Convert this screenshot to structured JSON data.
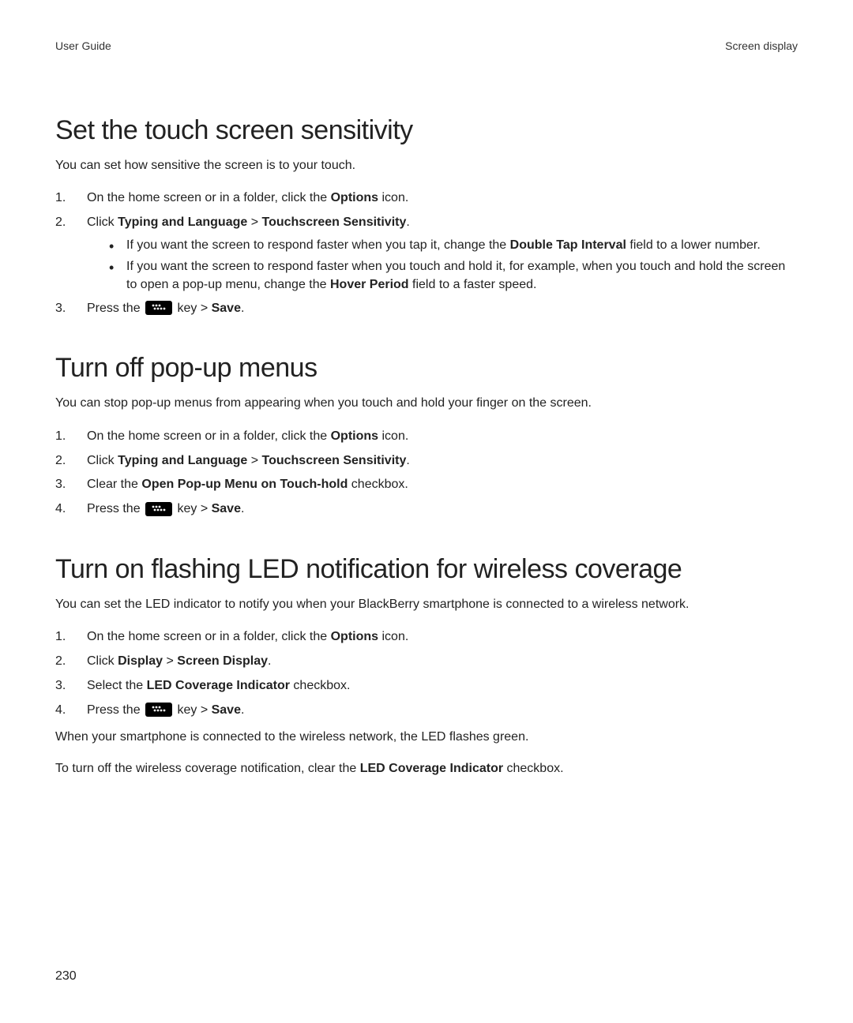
{
  "header": {
    "left": "User Guide",
    "right": "Screen display"
  },
  "page_number": "230",
  "sections": [
    {
      "title": "Set the touch screen sensitivity",
      "intro": "You can set how sensitive the screen is to your touch.",
      "steps": [
        {
          "prefix": "On the home screen or in a folder, click the ",
          "bold": "Options",
          "suffix": " icon."
        },
        {
          "prefix": "Click ",
          "bold": "Typing and Language",
          "mid1": " > ",
          "bold2": "Touchscreen Sensitivity",
          "suffix": ".",
          "bullets": [
            {
              "prefix": "If you want the screen to respond faster when you tap it, change the ",
              "bold": "Double Tap Interval",
              "suffix": " field to a lower number."
            },
            {
              "prefix": "If you want the screen to respond faster when you touch and hold it, for example, when you touch and hold the screen to open a pop-up menu, change the ",
              "bold": "Hover Period",
              "suffix": " field to a faster speed."
            }
          ]
        },
        {
          "press_prefix": "Press the ",
          "press_mid": " key > ",
          "press_bold": "Save",
          "press_suffix": "."
        }
      ]
    },
    {
      "title": "Turn off pop-up menus",
      "intro": "You can stop pop-up menus from appearing when you touch and hold your finger on the screen.",
      "steps": [
        {
          "prefix": "On the home screen or in a folder, click the ",
          "bold": "Options",
          "suffix": " icon."
        },
        {
          "prefix": "Click ",
          "bold": "Typing and Language",
          "mid1": " > ",
          "bold2": "Touchscreen Sensitivity",
          "suffix": "."
        },
        {
          "prefix": "Clear the ",
          "bold": "Open Pop-up Menu on Touch-hold",
          "suffix": " checkbox."
        },
        {
          "press_prefix": "Press the ",
          "press_mid": " key > ",
          "press_bold": "Save",
          "press_suffix": "."
        }
      ]
    },
    {
      "title": "Turn on flashing LED notification for wireless coverage",
      "intro": "You can set the LED indicator to notify you when your BlackBerry smartphone is connected to a wireless network.",
      "steps": [
        {
          "prefix": "On the home screen or in a folder, click the ",
          "bold": "Options",
          "suffix": " icon."
        },
        {
          "prefix": "Click ",
          "bold": "Display",
          "mid1": " > ",
          "bold2": "Screen Display",
          "suffix": "."
        },
        {
          "prefix": "Select the ",
          "bold": "LED Coverage Indicator",
          "suffix": " checkbox."
        },
        {
          "press_prefix": "Press the ",
          "press_mid": " key > ",
          "press_bold": "Save",
          "press_suffix": "."
        }
      ],
      "after": [
        "When your smartphone is connected to the wireless network, the LED flashes green.",
        {
          "prefix": "To turn off the wireless coverage notification, clear the ",
          "bold": "LED Coverage Indicator",
          "suffix": " checkbox."
        }
      ]
    }
  ]
}
